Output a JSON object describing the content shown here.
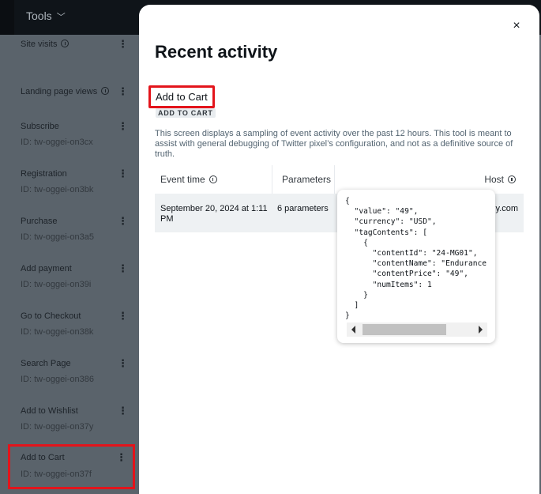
{
  "topbar": {
    "tools_label": "Tools"
  },
  "sidebar": {
    "items": [
      {
        "name": "Site visits",
        "id": "",
        "info": true
      },
      {
        "name": "Landing page views",
        "id": "",
        "info": true
      },
      {
        "name": "Subscribe",
        "id": "ID: tw-oggei-on3cx"
      },
      {
        "name": "Registration",
        "id": "ID: tw-oggei-on3bk"
      },
      {
        "name": "Purchase",
        "id": "ID: tw-oggei-on3a5"
      },
      {
        "name": "Add payment",
        "id": "ID: tw-oggei-on39i"
      },
      {
        "name": "Go to Checkout",
        "id": "ID: tw-oggei-on38k"
      },
      {
        "name": "Search Page",
        "id": "ID: tw-oggei-on386"
      },
      {
        "name": "Add to Wishlist",
        "id": "ID: tw-oggei-on37y"
      },
      {
        "name": "Add to Cart",
        "id": "ID: tw-oggei-on37f",
        "highlighted": true
      }
    ]
  },
  "modal": {
    "close_glyph": "×",
    "title": "Recent activity",
    "event_name": "Add to Cart",
    "event_chip": "ADD TO CART",
    "description": "This screen displays a sampling of event activity over the past 12 hours. This tool is meant to assist with general debugging of Twitter pixel’s configuration, and not as a definitive source of truth.",
    "table": {
      "headers": {
        "time": "Event time",
        "params": "Parameters",
        "host": "Host"
      },
      "rows": [
        {
          "time": "September 20, 2024 at 1:11 PM",
          "params": "6 parameters",
          "host": "y.com"
        }
      ]
    },
    "popover_json": "{\n  \"value\": \"49\",\n  \"currency\": \"USD\",\n  \"tagContents\": [\n    {\n      \"contentId\": \"24-MG01\",\n      \"contentName\": \"Endurance\n      \"contentPrice\": \"49\",\n      \"numItems\": 1\n    }\n  ]\n}"
  },
  "colors": {
    "highlight": "#e3141b",
    "overlay": "#5a636b",
    "topbar": "#0f1419"
  }
}
